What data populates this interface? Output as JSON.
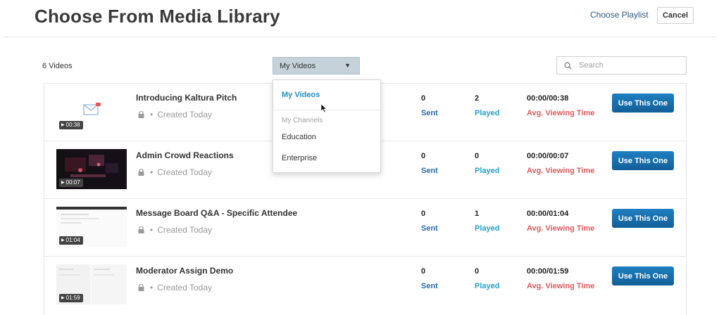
{
  "header": {
    "title": "Choose From Media Library",
    "choose_playlist_label": "Choose Playlist",
    "cancel_label": "Cancel"
  },
  "toolbar": {
    "video_count": "6 Videos",
    "filter_selected": "My Videos",
    "search_placeholder": "Search"
  },
  "dropdown": {
    "items": [
      "My Videos"
    ],
    "channels_header": "My Channels",
    "channel_items": [
      "Education",
      "Enterprise"
    ]
  },
  "videos": [
    {
      "title": "Introducing Kaltura Pitch",
      "created": "Created Today",
      "duration": "00:38",
      "sent": "0",
      "sent_label": "Sent",
      "played": "2",
      "played_label": "Played",
      "viewing_time": "00:00/00:38",
      "viewing_label": "Avg. Viewing Time",
      "button_label": "Use This One"
    },
    {
      "title": "Admin Crowd Reactions",
      "created": "Created Today",
      "duration": "00:07",
      "sent": "0",
      "sent_label": "Sent",
      "played": "0",
      "played_label": "Played",
      "viewing_time": "00:00/00:07",
      "viewing_label": "Avg. Viewing Time",
      "button_label": "Use This One"
    },
    {
      "title": "Message Board Q&A - Specific Attendee",
      "created": "Created Today",
      "duration": "01:04",
      "sent": "0",
      "sent_label": "Sent",
      "played": "1",
      "played_label": "Played",
      "viewing_time": "00:00/01:04",
      "viewing_label": "Avg. Viewing Time",
      "button_label": "Use This One"
    },
    {
      "title": "Moderator Assign Demo",
      "created": "Created Today",
      "duration": "01:59",
      "sent": "0",
      "sent_label": "Sent",
      "played": "0",
      "played_label": "Played",
      "viewing_time": "00:00/01:59",
      "viewing_label": "Avg. Viewing Time",
      "button_label": "Use This One"
    }
  ],
  "colors": {
    "accent": "#1f8fc4",
    "button": "#1a6fab",
    "sent": "#2b6cb0",
    "played": "#25a0c9",
    "avg": "#e0595a"
  }
}
